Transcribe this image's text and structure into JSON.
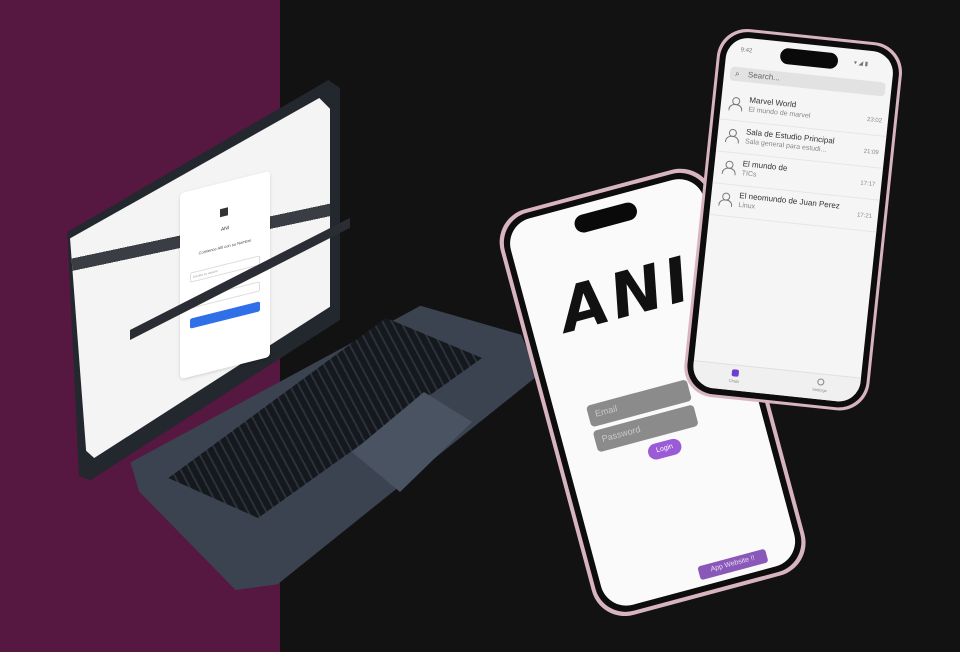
{
  "colors": {
    "left_background": "#561741",
    "right_background": "#121212",
    "accent_purple": "#9b5bd6",
    "phone_frame": "#d8b5be"
  },
  "laptop": {
    "app_name": "ANI",
    "login_title": "Comience Allí con su Nombre",
    "username_placeholder": "Escriba su usuario",
    "password_placeholder": "Password"
  },
  "login_phone": {
    "logo": "ANI",
    "email_placeholder": "Email",
    "password_placeholder": "Password",
    "login_label": "Login",
    "help_label": "App Website !!"
  },
  "chat_phone": {
    "status_time": "9:42",
    "status_icons": "▾ ◢ ▮",
    "search_icon": "search-icon",
    "search_placeholder": "Search...",
    "chats": [
      {
        "name": "Marvel World",
        "preview": "El mundo de marvel",
        "time": "23:02"
      },
      {
        "name": "Sala de Estudio Principal",
        "preview": "Sala general para estudi...",
        "time": "21:09"
      },
      {
        "name": "El mundo de",
        "preview": "TICs",
        "time": "17:17"
      },
      {
        "name": "El neomundo de Juan Perez",
        "preview": "Linux",
        "time": "17:21"
      }
    ],
    "nav": {
      "chats": "Chats",
      "settings": "Settings"
    }
  }
}
